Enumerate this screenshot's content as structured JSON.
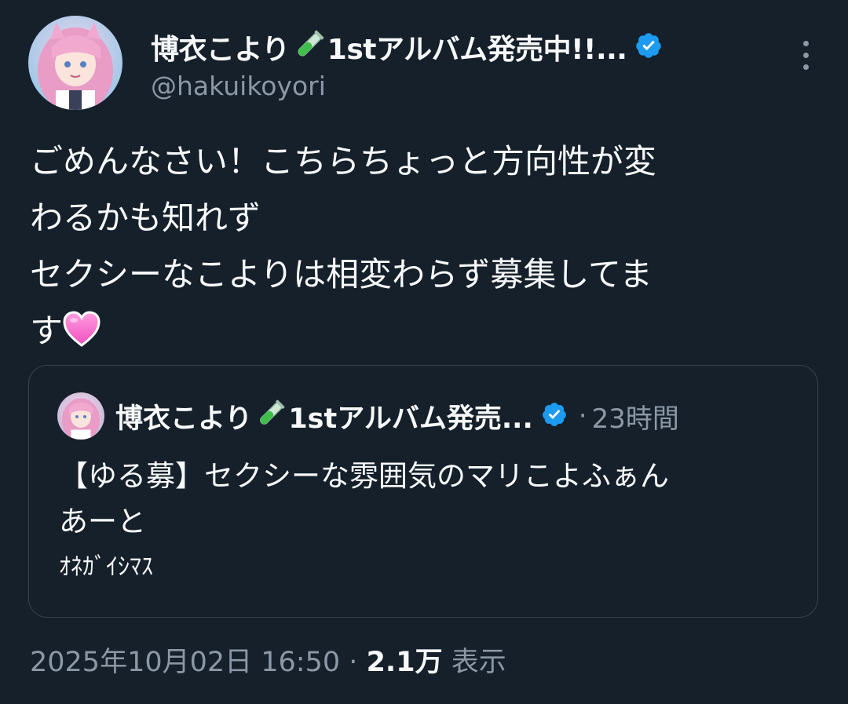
{
  "author": {
    "name_prefix": "博衣こより",
    "name_suffix": "1stアルバム発売中!!...",
    "handle": "@hakuikoyori",
    "verified_icon": "verified-badge-icon",
    "accent": "#1d9bf0"
  },
  "tweet": {
    "lines": [
      "ごめんなさい！こちらちょっと方向性が変",
      "わるかも知れず",
      "セクシーなこよりは相変わらず募集してま",
      "す"
    ],
    "emoji": "pink-heart-icon"
  },
  "quoted": {
    "name_prefix": "博衣こより",
    "name_suffix": "1stアルバム発売...",
    "separator": "·",
    "time": "23時間",
    "lines": [
      "【ゆる募】セクシーな雰囲気のマリこよふぁん",
      "あーと",
      "ｵﾈｶﾞｲｼﾏｽ"
    ]
  },
  "footer": {
    "timestamp": "2025年10月02日 16:50",
    "separator": "·",
    "views": "2.1万",
    "views_label": "表示"
  }
}
